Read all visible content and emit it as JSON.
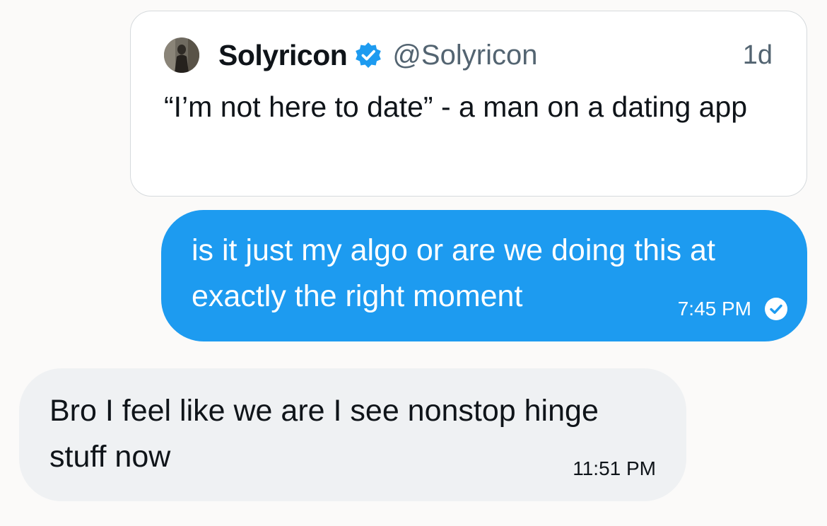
{
  "quoted_post": {
    "author_name": "Solyricon",
    "author_handle": "@Solyricon",
    "time_ago": "1d",
    "text": "“I’m not here to date” - a man on a dating app",
    "avatar_icon": "user-avatar-photo",
    "verified_icon": "verified-badge-icon"
  },
  "messages": [
    {
      "direction": "sent",
      "text": "is it just my algo or are we doing this at exactly the right moment",
      "time": "7:45 PM",
      "status_icon": "read-check-icon"
    },
    {
      "direction": "received",
      "text": "Bro I feel like we are I see nonstop hinge stuff now",
      "time": "11:51 PM"
    }
  ],
  "colors": {
    "background": "#fbfaf9",
    "sent_bubble": "#1d9bf0",
    "received_bubble": "#eff1f3",
    "verified_badge": "#1d9bf0",
    "secondary_text": "#536471",
    "primary_text": "#0f1419"
  }
}
